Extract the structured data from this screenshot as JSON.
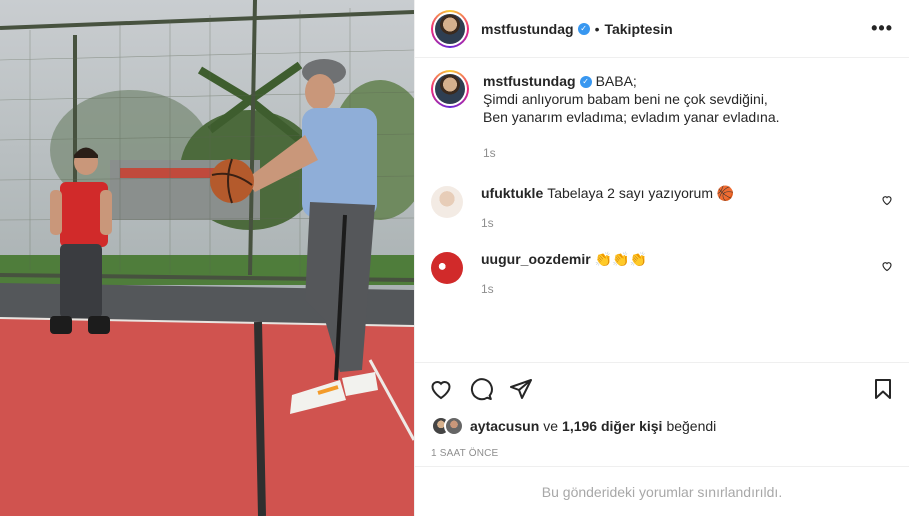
{
  "post": {
    "author": "mstfustundag",
    "follow_status": "Takiptesin",
    "dot": "•",
    "more_icon": "more-horizontal-icon",
    "caption_lines": [
      "BABA;",
      "Şimdi anlıyorum babam beni ne çok sevdiğini,",
      "Ben yanarım evladıma; evladım yanar evladına."
    ],
    "caption_time": "1s"
  },
  "comments": [
    {
      "user": "ufuktukle",
      "text": "Tabelaya 2 sayı yazıyorum 🏀",
      "time": "1s"
    },
    {
      "user": "uugur_oozdemir",
      "text": "👏👏👏",
      "time": "1s"
    }
  ],
  "likes": {
    "first_user": "aytacusun",
    "connector": "ve",
    "others": "1,196 diğer kişi",
    "suffix": "beğendi"
  },
  "time_ago": "1 SAAT ÖNCE",
  "restricted_notice": "Bu gönderideki yorumlar sınırlandırıldı.",
  "colors": {
    "verified": "#3897f0",
    "court": "#d0534f",
    "muted": "#8e8e8e"
  }
}
